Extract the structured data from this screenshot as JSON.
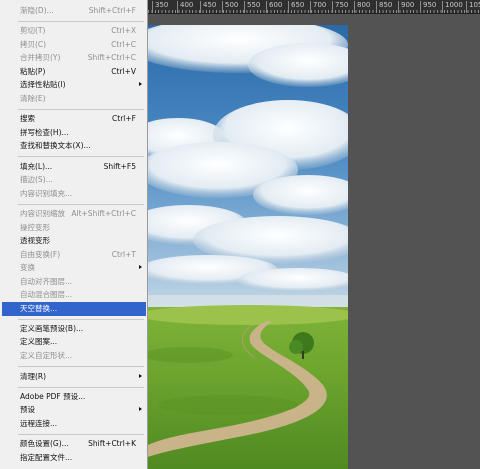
{
  "ruler": {
    "labels": [
      "350",
      "400",
      "450",
      "500",
      "550",
      "600",
      "650",
      "700",
      "750",
      "800",
      "850",
      "900",
      "950",
      "1000",
      "1050"
    ]
  },
  "menu": {
    "items": [
      {
        "label": "渐隐(D)...",
        "shortcut": "Shift+Ctrl+F",
        "disabled": true
      },
      {
        "label": "剪切(T)",
        "shortcut": "Ctrl+X",
        "disabled": true
      },
      {
        "label": "拷贝(C)",
        "shortcut": "Ctrl+C",
        "disabled": true
      },
      {
        "label": "合并拷贝(Y)",
        "shortcut": "Shift+Ctrl+C",
        "disabled": true
      },
      {
        "label": "粘贴(P)",
        "shortcut": "Ctrl+V",
        "disabled": false
      },
      {
        "label": "选择性粘贴(I)",
        "shortcut": "",
        "disabled": false,
        "submenu": true
      },
      {
        "label": "清除(E)",
        "shortcut": "",
        "disabled": true
      },
      {
        "label": "搜索",
        "shortcut": "Ctrl+F",
        "disabled": false
      },
      {
        "label": "拼写检查(H)...",
        "shortcut": "",
        "disabled": false
      },
      {
        "label": "查找和替换文本(X)...",
        "shortcut": "",
        "disabled": false
      },
      {
        "label": "填充(L)...",
        "shortcut": "Shift+F5",
        "disabled": false
      },
      {
        "label": "描边(S)...",
        "shortcut": "",
        "disabled": true
      },
      {
        "label": "内容识别填充...",
        "shortcut": "",
        "disabled": true
      },
      {
        "label": "内容识别缩放",
        "shortcut": "Alt+Shift+Ctrl+C",
        "disabled": true
      },
      {
        "label": "操控变形",
        "shortcut": "",
        "disabled": true
      },
      {
        "label": "透视变形",
        "shortcut": "",
        "disabled": false
      },
      {
        "label": "自由变换(F)",
        "shortcut": "Ctrl+T",
        "disabled": true
      },
      {
        "label": "变换",
        "shortcut": "",
        "disabled": true,
        "submenu": true
      },
      {
        "label": "自动对齐图层...",
        "shortcut": "",
        "disabled": true
      },
      {
        "label": "自动混合图层...",
        "shortcut": "",
        "disabled": true
      },
      {
        "label": "天空替换...",
        "shortcut": "",
        "disabled": false,
        "highlighted": true
      },
      {
        "label": "定义画笔预设(B)...",
        "shortcut": "",
        "disabled": false
      },
      {
        "label": "定义图案...",
        "shortcut": "",
        "disabled": false
      },
      {
        "label": "定义自定形状...",
        "shortcut": "",
        "disabled": true
      },
      {
        "label": "清理(R)",
        "shortcut": "",
        "disabled": false,
        "submenu": true
      },
      {
        "label": "Adobe PDF 预设...",
        "shortcut": "",
        "disabled": false
      },
      {
        "label": "预设",
        "shortcut": "",
        "disabled": false,
        "submenu": true
      },
      {
        "label": "远程连接...",
        "shortcut": "",
        "disabled": false
      },
      {
        "label": "颜色设置(G)...",
        "shortcut": "Shift+Ctrl+K",
        "disabled": false
      },
      {
        "label": "指定配置文件...",
        "shortcut": "",
        "disabled": false
      }
    ]
  },
  "colors": {
    "highlight": "#3165cb",
    "menu_bg": "#f0f0f0",
    "workspace_bg": "#535353"
  }
}
